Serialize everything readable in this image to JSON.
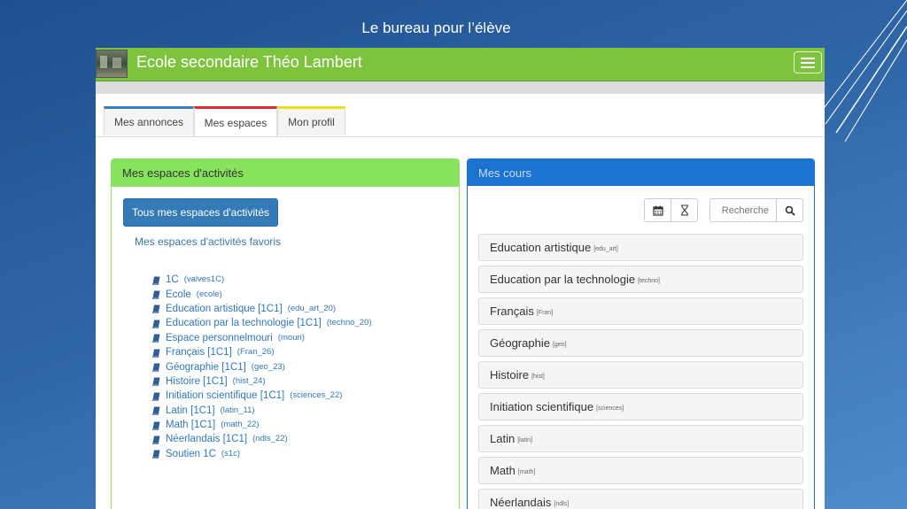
{
  "slide": {
    "title": "Le bureau pour  l’élève"
  },
  "navbar": {
    "brand": "Ecole secondaire Théo Lambert"
  },
  "tabs": [
    {
      "label": "Mes annonces",
      "accent": "#3a7ebf"
    },
    {
      "label": "Mes espaces",
      "accent": "#d9302a",
      "active": true
    },
    {
      "label": "Mon profil",
      "accent": "#e8df1d"
    }
  ],
  "left_panel": {
    "title": "Mes espaces d'activités",
    "all_button": "Tous mes espaces d'activités",
    "favorites_link": "Mes espaces d'activités favoris",
    "spaces": [
      {
        "name": "1C",
        "code": "(valves1C)"
      },
      {
        "name": "Ecole",
        "code": "(ecole)"
      },
      {
        "name": "Education artistique [1C1]",
        "code": "(edu_art_20)"
      },
      {
        "name": "Education par la technologie [1C1]",
        "code": "(techno_20)"
      },
      {
        "name": "Espace personnelmouri",
        "code": "(mouri)"
      },
      {
        "name": "Français [1C1]",
        "code": "(Fran_26)"
      },
      {
        "name": "Géographie [1C1]",
        "code": "(geo_23)"
      },
      {
        "name": "Histoire [1C1]",
        "code": "(hist_24)"
      },
      {
        "name": "Initiation scientifique [1C1]",
        "code": "(sciences_22)"
      },
      {
        "name": "Latin [1C1]",
        "code": "(latin_11)"
      },
      {
        "name": "Math [1C1]",
        "code": "(math_22)"
      },
      {
        "name": "Néerlandais [1C1]",
        "code": "(ndls_22)"
      },
      {
        "name": "Soutien 1C",
        "code": "(s1c)"
      }
    ]
  },
  "right_panel": {
    "title": "Mes cours",
    "search_placeholder": "Recherche",
    "courses": [
      {
        "name": "Education artistique",
        "code": "[edu_art]"
      },
      {
        "name": "Education par la technologie",
        "code": "[techno]"
      },
      {
        "name": "Français",
        "code": "[Fran]"
      },
      {
        "name": "Géographie",
        "code": "[geo]"
      },
      {
        "name": "Histoire",
        "code": "[hist]"
      },
      {
        "name": "Initiation scientifique",
        "code": "[sciences]"
      },
      {
        "name": "Latin",
        "code": "[latin]"
      },
      {
        "name": "Math",
        "code": "[math]"
      },
      {
        "name": "Néerlandais",
        "code": "[ndls]"
      }
    ]
  },
  "colors": {
    "navbar": "#7ec33e",
    "left_panel": "#86e35b",
    "right_panel": "#1a73d1",
    "primary": "#337ab7"
  },
  "icons": [
    "calendar-icon",
    "hourglass-icon",
    "search-icon",
    "book-icon",
    "menu-icon"
  ]
}
